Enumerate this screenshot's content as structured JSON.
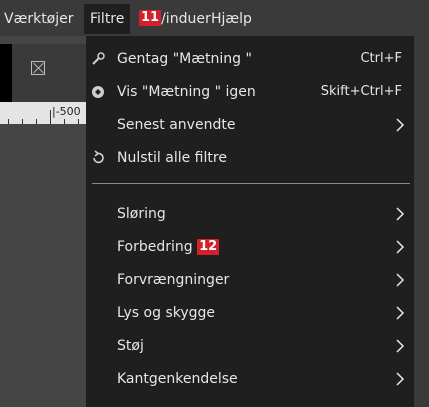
{
  "menubar": {
    "items": [
      {
        "label": "Værktøjer"
      },
      {
        "label": "Filtre"
      },
      {
        "label": "Vinduer",
        "label_visible": "/induer",
        "badge": "11"
      },
      {
        "label": "Hjælp"
      }
    ]
  },
  "ruler": {
    "label": "|-500"
  },
  "menu": {
    "items": [
      {
        "label": "Gentag \"Mætning \"",
        "accel": "Ctrl+F",
        "icon": "repeat-filter-icon"
      },
      {
        "label": "Vis \"Mætning \" igen",
        "accel": "Skift+Ctrl+F",
        "icon": "reshow-filter-icon"
      },
      {
        "label": "Senest anvendte",
        "submenu": true
      },
      {
        "label": "Nulstil alle filtre",
        "icon": "reset-icon"
      },
      {
        "label": "Sløring",
        "submenu": true
      },
      {
        "label": "Forbedring",
        "badge": "12",
        "submenu": true
      },
      {
        "label": "Forvrængninger",
        "submenu": true
      },
      {
        "label": "Lys og skygge",
        "submenu": true
      },
      {
        "label": "Støj",
        "submenu": true
      },
      {
        "label": "Kantgenkendelse",
        "submenu": true
      }
    ]
  },
  "colors": {
    "menu_bg": "#1f1f1f",
    "menubar_bg": "#3a3a3a",
    "badge": "#d4202a",
    "text": "#e6e6e6"
  }
}
